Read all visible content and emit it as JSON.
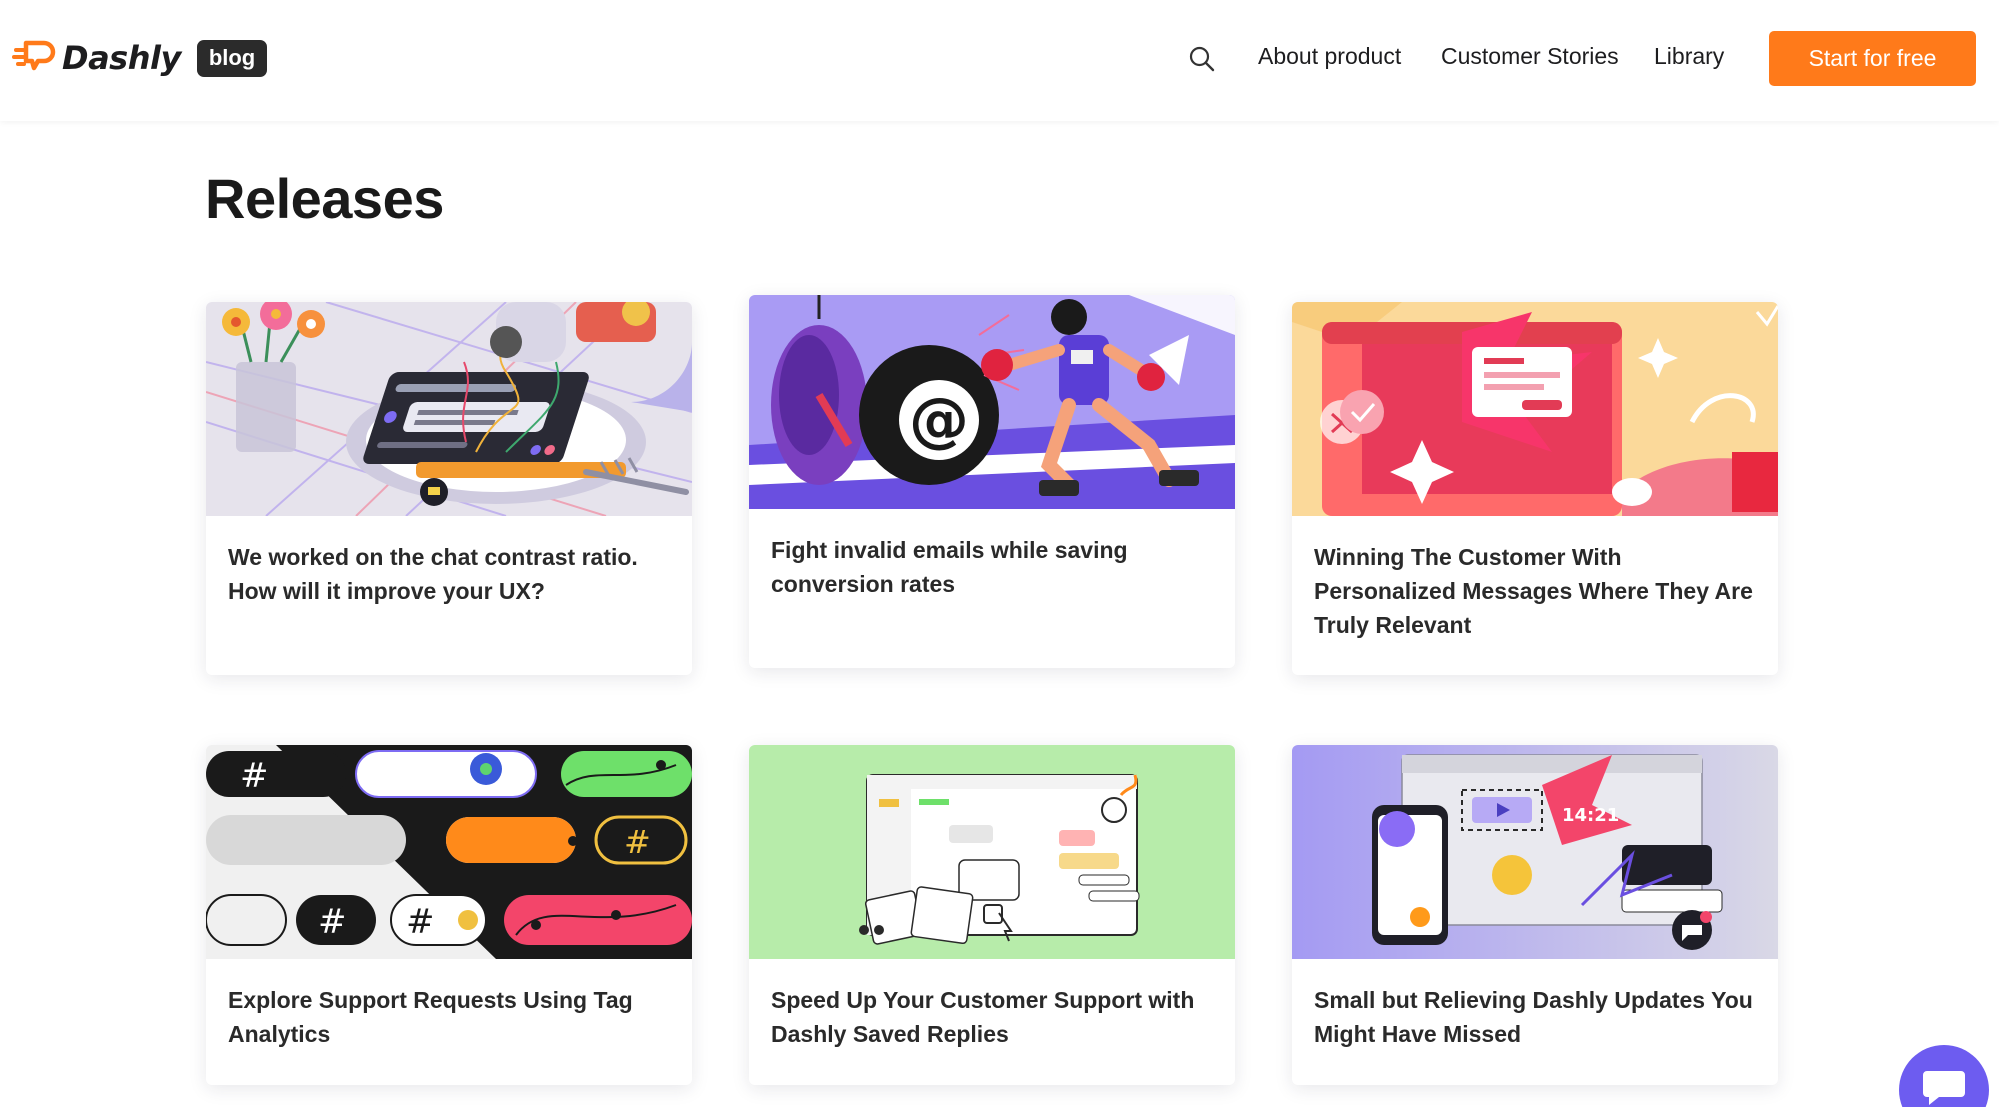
{
  "header": {
    "logo_text": "Dashly",
    "badge": "blog",
    "nav": [
      "About product",
      "Customer Stories",
      "Library"
    ],
    "cta": "Start for free",
    "colors": {
      "accent": "#ff7a1a",
      "badge_bg": "#2b2b2b"
    }
  },
  "page": {
    "title": "Releases"
  },
  "cards": [
    {
      "title": "We worked on the chat contrast ratio. How will it improve your UX?",
      "image": "chat-contrast-illustration"
    },
    {
      "title": "Fight invalid emails while saving conversion rates",
      "image": "boxing-emails-illustration"
    },
    {
      "title": "Winning The Customer With Personalized Messages Where They Are Truly Relevant",
      "image": "personalized-messages-illustration"
    },
    {
      "title": "Explore Support Requests Using Tag Analytics",
      "image": "tag-analytics-illustration"
    },
    {
      "title": "Speed Up Your Customer Support with Dashly Saved Replies",
      "image": "saved-replies-illustration"
    },
    {
      "title": "Small but Relieving Dashly Updates You Might Have Missed",
      "image": "dashly-updates-illustration"
    }
  ],
  "chat_widget": {
    "icon": "chat-icon",
    "color": "#6d5cf0"
  }
}
